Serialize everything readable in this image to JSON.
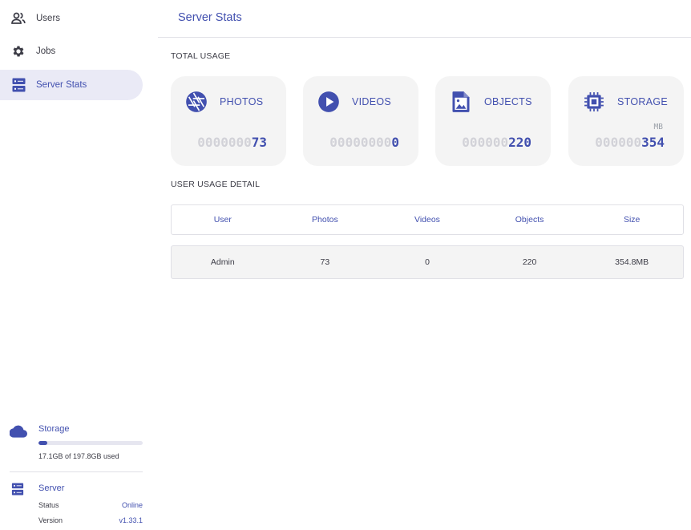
{
  "colors": {
    "accent": "#4250af",
    "active_bg": "#eaeaf6",
    "card_bg": "#f4f4f4",
    "text": "#3c3c46"
  },
  "sidebar": {
    "items": [
      {
        "label": "Users",
        "icon": "users-icon",
        "active": false
      },
      {
        "label": "Jobs",
        "icon": "gear-icon",
        "active": false
      },
      {
        "label": "Server Stats",
        "icon": "server-icon",
        "active": true
      }
    ],
    "storage": {
      "title": "Storage",
      "used_text": "17.1GB of 197.8GB used",
      "used_fraction": 0.086,
      "icon": "cloud-icon"
    },
    "server": {
      "title": "Server",
      "icon": "server-icon",
      "status_label": "Status",
      "status_value": "Online",
      "version_label": "Version",
      "version_value": "v1.33.1"
    }
  },
  "header": {
    "title": "Server Stats"
  },
  "total_usage": {
    "label": "TOTAL USAGE",
    "cards": [
      {
        "label": "PHOTOS",
        "icon": "camera-aperture-icon",
        "pad": "0000000",
        "value": "73",
        "unit": ""
      },
      {
        "label": "VIDEOS",
        "icon": "play-circle-icon",
        "pad": "00000000",
        "value": "0",
        "unit": ""
      },
      {
        "label": "OBJECTS",
        "icon": "image-file-icon",
        "pad": "000000",
        "value": "220",
        "unit": ""
      },
      {
        "label": "STORAGE",
        "icon": "chip-icon",
        "pad": "000000",
        "value": "354",
        "unit": "MB"
      }
    ]
  },
  "user_usage": {
    "label": "USER USAGE DETAIL",
    "columns": [
      "User",
      "Photos",
      "Videos",
      "Objects",
      "Size"
    ],
    "rows": [
      [
        "Admin",
        "73",
        "0",
        "220",
        "354.8MB"
      ]
    ]
  }
}
